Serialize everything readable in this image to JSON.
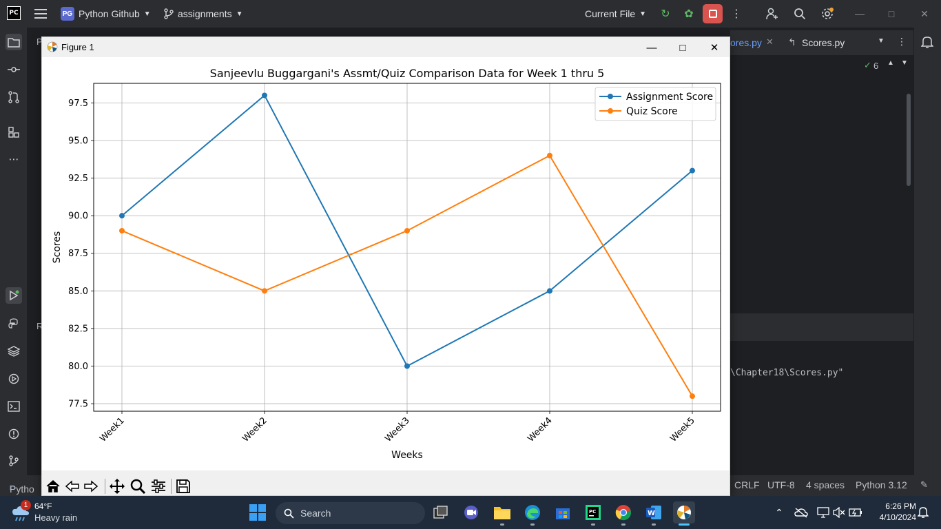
{
  "ide": {
    "logo": "PC",
    "project_badge": "PG",
    "project_name": "Python Github",
    "branch": "assignments",
    "run_config": "Current File",
    "tabs": [
      "ores.py",
      "Scores.py"
    ],
    "inspection_count": "6",
    "console_line": "\\Chapter18\\Scores.py\"",
    "left_strip_labels": [
      "P",
      "R"
    ],
    "status": {
      "left_label": "Pytho",
      "line_sep": "CRLF",
      "encoding": "UTF-8",
      "indent": "4 spaces",
      "interpreter": "Python 3.12"
    }
  },
  "figure": {
    "window_title": "Figure 1"
  },
  "chart_data": {
    "type": "line",
    "title": "Sanjeevlu Buggargani's  Assmt/Quiz Comparison Data for Week 1 thru 5",
    "xlabel": "Weeks",
    "ylabel": "Scores",
    "categories": [
      "Week1",
      "Week2",
      "Week3",
      "Week4",
      "Week5"
    ],
    "series": [
      {
        "name": "Assignment Score",
        "values": [
          90,
          98,
          80,
          85,
          93
        ],
        "color": "#1f77b4"
      },
      {
        "name": "Quiz Score",
        "values": [
          89,
          85,
          89,
          94,
          78
        ],
        "color": "#ff7f0e"
      }
    ],
    "ylim": [
      77.0,
      98.8
    ],
    "yticks": [
      "77.5",
      "80.0",
      "82.5",
      "85.0",
      "87.5",
      "90.0",
      "92.5",
      "95.0",
      "97.5"
    ],
    "grid": true,
    "legend": "upper right",
    "marker": "circle",
    "x_tick_rotation": "45"
  },
  "taskbar": {
    "weather_temp": "64°F",
    "weather_desc": "Heavy rain",
    "weather_badge": "1",
    "search_placeholder": "Search",
    "time": "6:26 PM",
    "date": "4/10/2024"
  }
}
